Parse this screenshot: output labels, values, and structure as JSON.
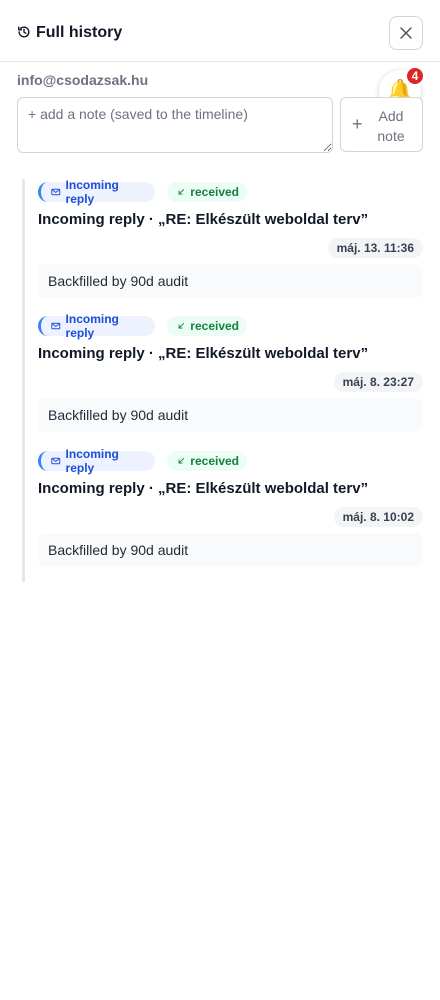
{
  "header": {
    "title": "Full history",
    "history_icon": "history-icon",
    "close_icon": "close-icon"
  },
  "contact": {
    "email": "info@csodazsak.hu"
  },
  "notifications": {
    "icon": "bell-icon",
    "count": "4"
  },
  "note": {
    "placeholder": "+ add a note (saved to the timeline)",
    "value": "",
    "add_button_label": "Add note",
    "add_icon": "plus-icon"
  },
  "colors": {
    "reply_accent": "#3b82f6",
    "reply_text": "#1d4ed8",
    "received_text": "#15803d",
    "badge_red": "#dc2626"
  },
  "events": [
    {
      "type_label": "Incoming reply",
      "type_icon": "mail-icon",
      "status_label": "received",
      "status_icon": "arrow-down-left-icon",
      "title": "Incoming reply · „RE: Elkészült weboldal terv”",
      "date": "máj. 13. 11:36",
      "body": "Backfilled by 90d audit"
    },
    {
      "type_label": "Incoming reply",
      "type_icon": "mail-icon",
      "status_label": "received",
      "status_icon": "arrow-down-left-icon",
      "title": "Incoming reply · „RE: Elkészült weboldal terv”",
      "date": "máj. 8. 23:27",
      "body": "Backfilled by 90d audit"
    },
    {
      "type_label": "Incoming reply",
      "type_icon": "mail-icon",
      "status_label": "received",
      "status_icon": "arrow-down-left-icon",
      "title": "Incoming reply · „RE: Elkészült weboldal terv”",
      "date": "máj. 8. 10:02",
      "body": "Backfilled by 90d audit"
    }
  ]
}
